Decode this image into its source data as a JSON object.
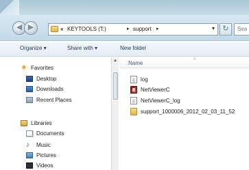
{
  "address_bar": {
    "breadcrumb_prefix": "«",
    "drive": "KEYTOOLS (T:)",
    "folder": "support",
    "separator": "▸",
    "dropdown_glyph": "▾",
    "refresh_glyph": "↻",
    "search_placeholder": "Sea"
  },
  "navigation_buttons": {
    "back_glyph": "◀",
    "forward_glyph": "▶"
  },
  "toolbar": {
    "organize": "Organize ▾",
    "share_with": "Share with ▾",
    "new_folder": "New folder"
  },
  "nav_pane": {
    "favorites": "Favorites",
    "favorites_items": [
      "Desktop",
      "Downloads",
      "Recent Places"
    ],
    "libraries": "Libraries",
    "libraries_items": [
      "Documents",
      "Music",
      "Pictures",
      "Videos"
    ],
    "star_glyph": "★",
    "music_glyph": "♪"
  },
  "content": {
    "column_name": "Name",
    "sort_glyph": "^",
    "files": [
      {
        "name": "log",
        "icon": "text-file-icon"
      },
      {
        "name": "NetViewerC",
        "icon": "application-icon"
      },
      {
        "name": "NetViewerC_log",
        "icon": "text-file-icon"
      },
      {
        "name": "support_1000006_2012_02_03_11_52",
        "icon": "folder-icon"
      }
    ]
  }
}
